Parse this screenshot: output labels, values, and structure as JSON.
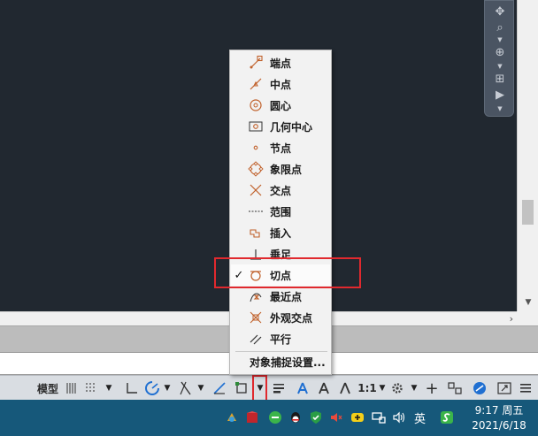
{
  "menu": {
    "items": [
      {
        "label": "端点",
        "icon": "endpoint-icon",
        "checked": false
      },
      {
        "label": "中点",
        "icon": "midpoint-icon",
        "checked": false
      },
      {
        "label": "圆心",
        "icon": "center-icon",
        "checked": false
      },
      {
        "label": "几何中心",
        "icon": "geometric-center-icon",
        "checked": false
      },
      {
        "label": "节点",
        "icon": "node-icon",
        "checked": false
      },
      {
        "label": "象限点",
        "icon": "quadrant-icon",
        "checked": false
      },
      {
        "label": "交点",
        "icon": "intersection-icon",
        "checked": false
      },
      {
        "label": "范围",
        "icon": "extension-icon",
        "checked": false
      },
      {
        "label": "插入",
        "icon": "insertion-icon",
        "checked": false
      },
      {
        "label": "垂足",
        "icon": "perpendicular-icon",
        "checked": false
      },
      {
        "label": "切点",
        "icon": "tangent-icon",
        "checked": true
      },
      {
        "label": "最近点",
        "icon": "nearest-icon",
        "checked": false
      },
      {
        "label": "外观交点",
        "icon": "apparent-intersection-icon",
        "checked": false
      },
      {
        "label": "平行",
        "icon": "parallel-icon",
        "checked": false
      }
    ],
    "settings_label": "对象捕捉设置...",
    "check_glyph": "✓"
  },
  "statusbar": {
    "model_label": "模型",
    "scale_label": "1:1"
  },
  "taskbar": {
    "ime_label": "英",
    "time": "9:17 周五",
    "date": "2021/6/18"
  },
  "colors": {
    "canvas": "#212830",
    "accent_red": "#e0292e",
    "taskbar": "#16587a",
    "snap_icon": "#c0602a",
    "blue_icon": "#1f6fd1"
  }
}
